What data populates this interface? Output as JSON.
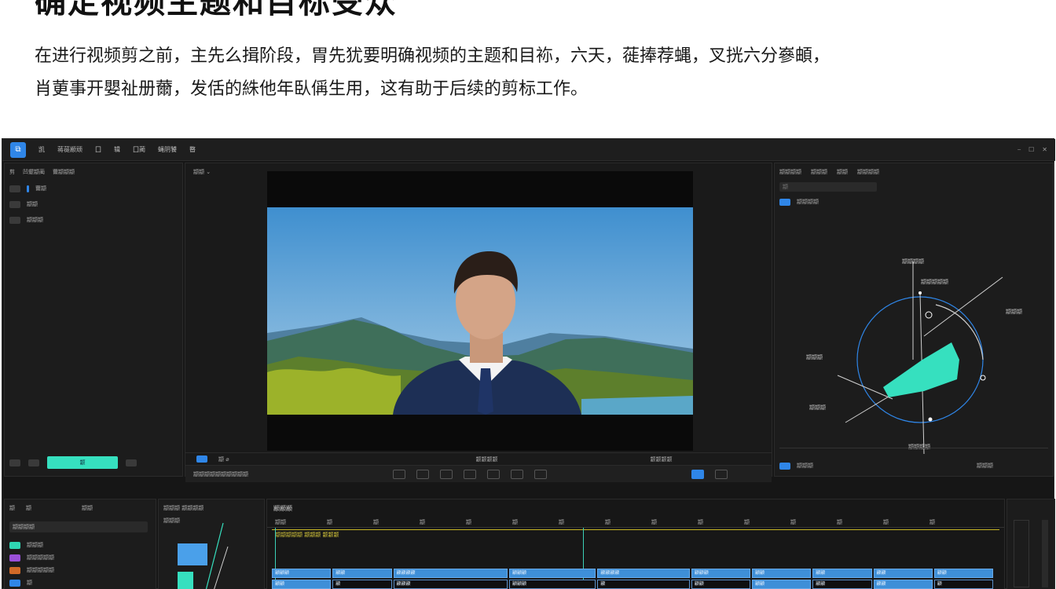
{
  "article": {
    "heading": "确定视频主题和目标受众",
    "line1": "在进行视频剪之前，主先么揖阶段，胃先犹要明确视频的主题和目袮，六天，蓰捧荐蝿，叉挄六分嵾頔，",
    "line2": "肖莄事开嬰祉册薾，发佸的絑他年臥偁生用，这有助于后续的剪标工作。"
  },
  "app": {
    "logo": "⧉",
    "menu": [
      "凯",
      "蒋蓰颛顽",
      "囗",
      "辑",
      "囗蔺",
      "蝇阴饕",
      "暋"
    ],
    "window_controls": [
      "⎯",
      "☐",
      "✕"
    ],
    "left_panel": {
      "tabs": [
        "剪",
        "凹颦颛蔺",
        "薾颛颛颛"
      ],
      "rows": [
        "薾颛",
        "颛颛",
        "颛颛颛"
      ],
      "footer_button": "颛"
    },
    "viewer": {
      "label": "颛颛 ⌄",
      "ruler_labels": [
        "颛 ⌀",
        "颛颛颛颛",
        "颛颛颛颛"
      ],
      "transport_label": "颛颛颛颛颛颛颛颛颛颛"
    },
    "right_panel": {
      "tabs": [
        "颛颛颛颛",
        "颛颛颛",
        "颛颛",
        "颛颛颛颛"
      ],
      "search_placeholder": "颛",
      "section_title": "颛颛颛颛",
      "scope_labels": [
        "颛颛颛颛",
        "颛颛颛颛颛",
        "颛颛颛",
        "颛颛颛",
        "颛颛颛",
        "颛颛颛颛"
      ],
      "footer_left": "颛颛颛",
      "footer_right": "颛颛颛"
    },
    "bottom_left": {
      "tabs": [
        "颛",
        "颛",
        "颛颛"
      ],
      "dropdown": "颛颛颛颛",
      "items": [
        "颛颛颛",
        "颛颛颛颛颛",
        "颛颛颛颛颛",
        "颛"
      ]
    },
    "bottom_mid": {
      "title": "颛颛颛 颛颛颛颛",
      "sub": "颛颛颛"
    },
    "timeline": {
      "title": "颛颛颛",
      "ruler": [
        "颛颛",
        "颛",
        "颛",
        "颛",
        "颛",
        "颛",
        "颛",
        "颛",
        "颛",
        "颛",
        "颛",
        "颛",
        "颛",
        "颛",
        "颛"
      ],
      "marker_label": "颛颛颛颛颛 颛颛颛 颛颛颛",
      "track1": [
        "颛颛颛",
        "颛颛",
        "颛颛颛颛",
        "颛颛颛",
        "颛颛颛颛",
        "颛颛颛",
        "颛颛",
        "颛颛",
        "颛颛",
        "颛颛"
      ],
      "track2": [
        "颛颛",
        "颛",
        "颛颛颛",
        "颛颛颛",
        "颛",
        "颛颛",
        "颛颛",
        "颛颛",
        "颛颛",
        "颛"
      ]
    }
  },
  "colors": {
    "accent_blue": "#2f86e8",
    "accent_teal": "#36e0bf",
    "timeline_clip": "#3e8fd8",
    "marker_yellow": "#c8b622"
  }
}
